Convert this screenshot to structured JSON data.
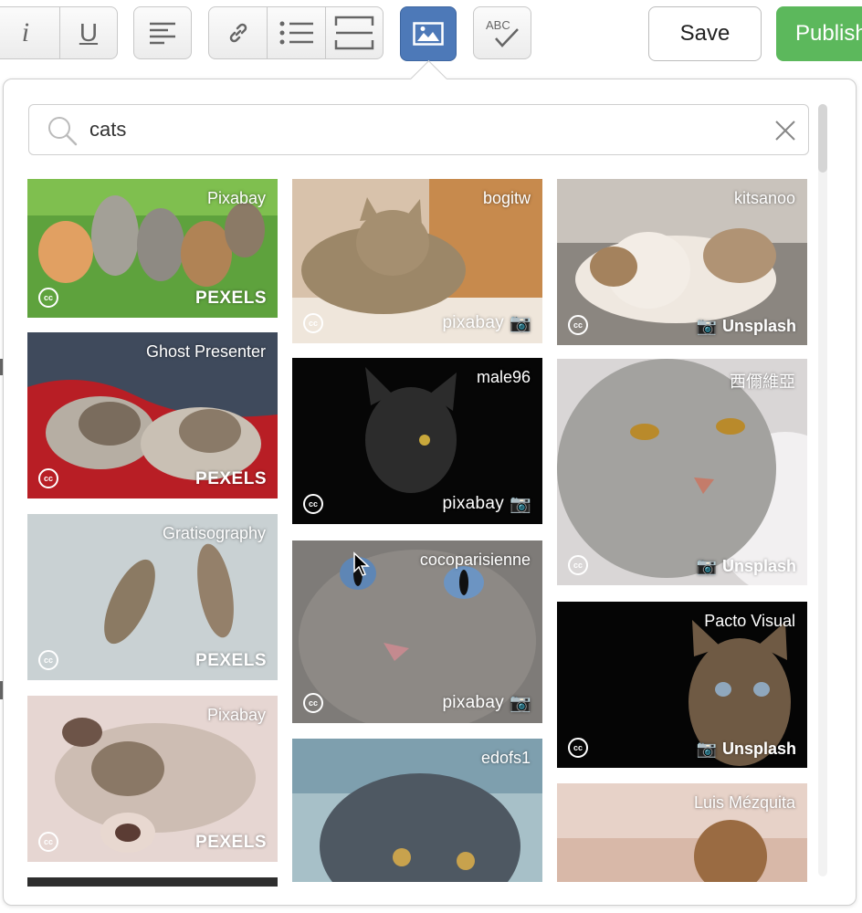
{
  "toolbar": {
    "italic_glyph": "i",
    "underline_glyph": "U",
    "save_label": "Save",
    "publish_label": "Publish",
    "icons": [
      "italic-icon",
      "underline-icon",
      "align-left-icon",
      "link-icon",
      "bullet-list-icon",
      "horizontal-rule-icon",
      "image-icon",
      "spellcheck-icon"
    ]
  },
  "search": {
    "value": "cats",
    "placeholder": ""
  },
  "colors": {
    "accent": "#4d79b8",
    "publish": "#5cb85c"
  },
  "images": [
    {
      "author": "Pixabay",
      "source": "PEXELS"
    },
    {
      "author": "Ghost Presenter",
      "source": "PEXELS"
    },
    {
      "author": "Gratisography",
      "source": "PEXELS"
    },
    {
      "author": "Pixabay",
      "source": "PEXELS"
    },
    {
      "author": "bogitw",
      "source": "pixabay"
    },
    {
      "author": "male96",
      "source": "pixabay"
    },
    {
      "author": "cocoparisienne",
      "source": "pixabay"
    },
    {
      "author": "edofs1",
      "source": ""
    },
    {
      "author": "kitsanoo",
      "source": "Unsplash"
    },
    {
      "author": "西儞維亞",
      "source": "Unsplash"
    },
    {
      "author": "Pacto Visual",
      "source": "Unsplash"
    },
    {
      "author": "Luis Mézquita",
      "source": ""
    }
  ],
  "license_badge": "cc"
}
